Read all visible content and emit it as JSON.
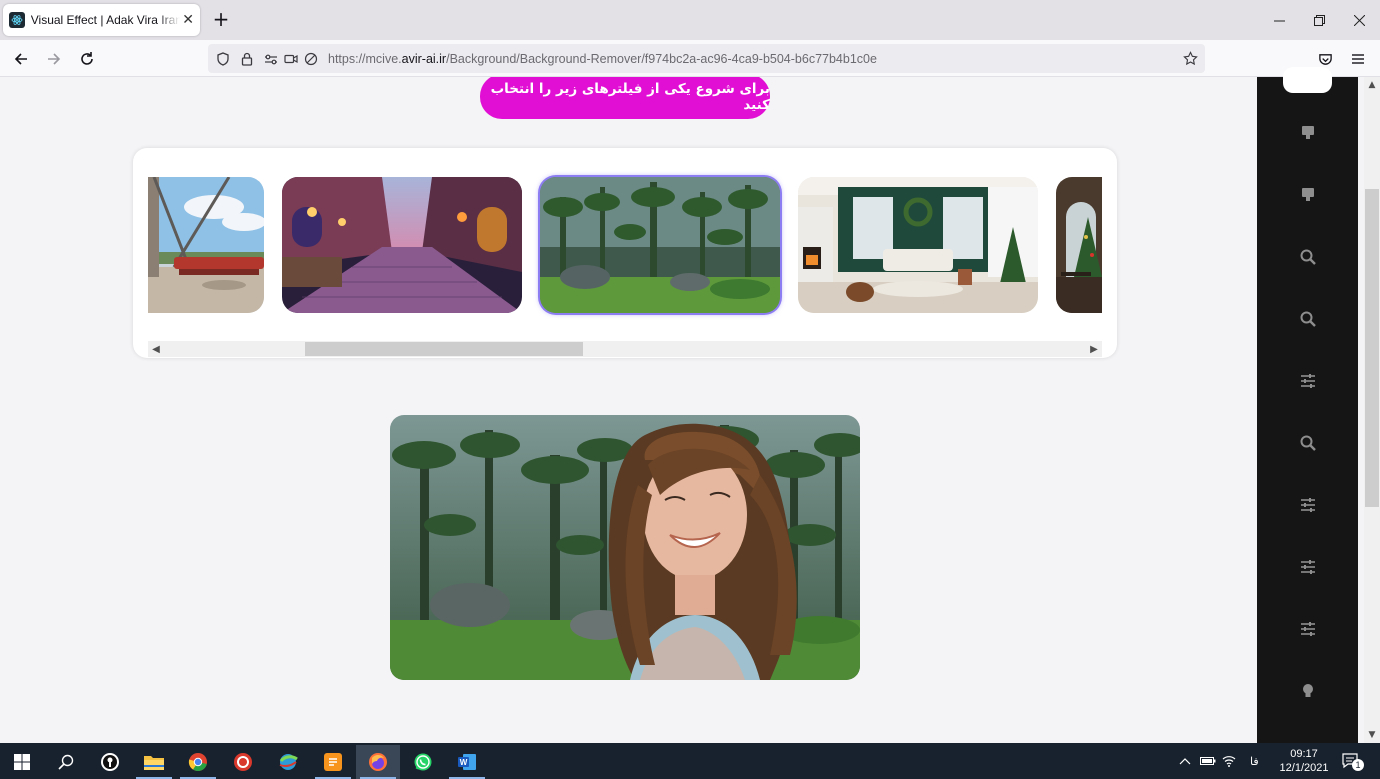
{
  "browser": {
    "tab_title": "Visual Effect | Adak Vira Iranidar",
    "new_tab_symbol": "+",
    "url_prefix": "https://mcive.",
    "url_domain": "avir-ai.ir",
    "url_path": "/Background/Background-Remover/f974bc2a-ac96-4ca9-b504-b6c77b4b1c0e"
  },
  "page": {
    "cta_label": "برای شروع یکی از فیلترهای زیر را انتخاب کنید",
    "gallery": [
      {
        "name": "modern-glass-lounge",
        "selected": false
      },
      {
        "name": "festive-cobblestone-street",
        "selected": false
      },
      {
        "name": "forest-scene",
        "selected": true
      },
      {
        "name": "christmas-living-room",
        "selected": false
      },
      {
        "name": "christmas-room-arched-window",
        "selected": false
      }
    ],
    "result_image": "woman-on-forest-background"
  },
  "sidebar": {
    "icons": [
      "comment-icon",
      "comment-icon",
      "search-icon",
      "search-icon",
      "sliders-icon",
      "search-icon",
      "sliders-icon",
      "sliders-icon",
      "sliders-icon",
      "bulb-icon"
    ]
  },
  "taskbar": {
    "lang": "فا",
    "time": "09:17",
    "date": "12/1/2021",
    "notif_count": "1"
  },
  "colors": {
    "accent": "#e10fd3",
    "selected_border": "#8d7df2",
    "sidebar_bg": "#151515",
    "taskbar_bg": "#18222e"
  }
}
